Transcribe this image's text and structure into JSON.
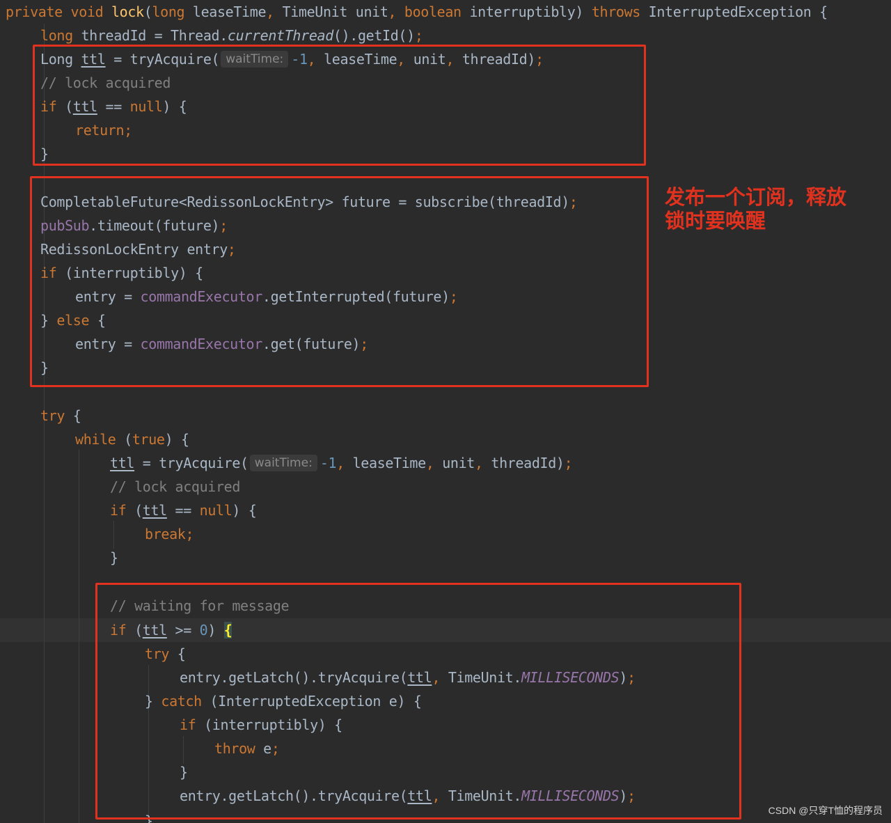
{
  "code": {
    "l1": {
      "kw1": "private void ",
      "fn": "lock",
      "p1": "(",
      "kw2": "long",
      "p2": " leaseTime",
      "c1": ", ",
      "p3": "TimeUnit unit",
      "c2": ", ",
      "kw3": "boolean",
      "p4": " interruptibly) ",
      "kw4": "throws",
      "p5": " InterruptedException {"
    },
    "l2": {
      "kw1": "long",
      "p1": " threadId = Thread.",
      "it": "currentThread",
      "p2": "().getId()",
      "sc": ";"
    },
    "l3": {
      "p1": "Long ",
      "v": "ttl",
      "p2": " = tryAcquire(",
      "hint": "waitTime:",
      "num": "-1",
      "c1": ", ",
      "p3": "leaseTime",
      "c2": ", ",
      "p4": "unit",
      "c3": ", ",
      "p5": "threadId)",
      "sc": ";"
    },
    "l4": {
      "cm": "// lock acquired"
    },
    "l5": {
      "kw1": "if",
      "p1": " (",
      "v": "ttl",
      "p2": " == ",
      "kw2": "null",
      "p3": ") {"
    },
    "l6": {
      "kw1": "return",
      "sc": ";"
    },
    "l7": {
      "p1": "}"
    },
    "l8": {
      "p1": "CompletableFuture<RedissonLockEntry> future = subscribe(threadId)",
      "sc": ";"
    },
    "l9": {
      "fld": "pubSub",
      "p1": ".timeout(future)",
      "sc": ";"
    },
    "l10": {
      "p1": "RedissonLockEntry entry",
      "sc": ";"
    },
    "l11": {
      "kw1": "if",
      "p1": " (interruptibly) {"
    },
    "l12": {
      "p1": "entry = ",
      "fld": "commandExecutor",
      "p2": ".getInterrupted(future)",
      "sc": ";"
    },
    "l13": {
      "p1": "} ",
      "kw1": "else",
      "p2": " {"
    },
    "l14": {
      "p1": "entry = ",
      "fld": "commandExecutor",
      "p2": ".get(future)",
      "sc": ";"
    },
    "l15": {
      "p1": "}"
    },
    "l16": {
      "kw1": "try",
      "p1": " {"
    },
    "l17": {
      "kw1": "while",
      "p1": " (",
      "kw2": "true",
      "p2": ") {"
    },
    "l18": {
      "v": "ttl",
      "p1": " = tryAcquire(",
      "hint": "waitTime:",
      "num": "-1",
      "c1": ", ",
      "p2": "leaseTime",
      "c2": ", ",
      "p3": "unit",
      "c3": ", ",
      "p4": "threadId)",
      "sc": ";"
    },
    "l19": {
      "cm": "// lock acquired"
    },
    "l20": {
      "kw1": "if",
      "p1": " (",
      "v": "ttl",
      "p2": " == ",
      "kw2": "null",
      "p3": ") {"
    },
    "l21": {
      "kw1": "break",
      "sc": ";"
    },
    "l22": {
      "p1": "}"
    },
    "l23": {
      "cm": "// waiting for message"
    },
    "l24": {
      "kw1": "if",
      "p1": " (",
      "v": "ttl",
      "p2": " >= ",
      "num": "0",
      "p3": ") ",
      "brace": "{"
    },
    "l25": {
      "kw1": "try",
      "p1": " {"
    },
    "l26": {
      "p1": "entry.getLatch().tryAcquire(",
      "v": "ttl",
      "c1": ", ",
      "p2": "TimeUnit.",
      "itf": "MILLISECONDS",
      "p3": ")",
      "sc": ";"
    },
    "l27": {
      "p1": "} ",
      "kw1": "catch",
      "p2": " (InterruptedException e) {"
    },
    "l28": {
      "kw1": "if",
      "p1": " (interruptibly) {"
    },
    "l29": {
      "kw1": "throw",
      "p1": " e",
      "sc": ";"
    },
    "l30": {
      "p1": "}"
    },
    "l31": {
      "p1": "entry.getLatch().tryAcquire(",
      "v": "ttl",
      "c1": ", ",
      "p2": "TimeUnit.",
      "itf": "MILLISECONDS",
      "p3": ")",
      "sc": ";"
    },
    "l32": {
      "p1": "}"
    }
  },
  "annotation": {
    "line1": "发布一个订阅，释放",
    "line2": "锁时要唤醒"
  },
  "watermark": "CSDN @只穿T恤的程序员",
  "colors": {
    "background": "#2b2b2b",
    "keyword": "#cc7832",
    "method_decl": "#ffc66d",
    "comment": "#808080",
    "number": "#6897bb",
    "field": "#9876aa",
    "plain": "#a9b7c6",
    "highlight_box": "#e0321e"
  }
}
